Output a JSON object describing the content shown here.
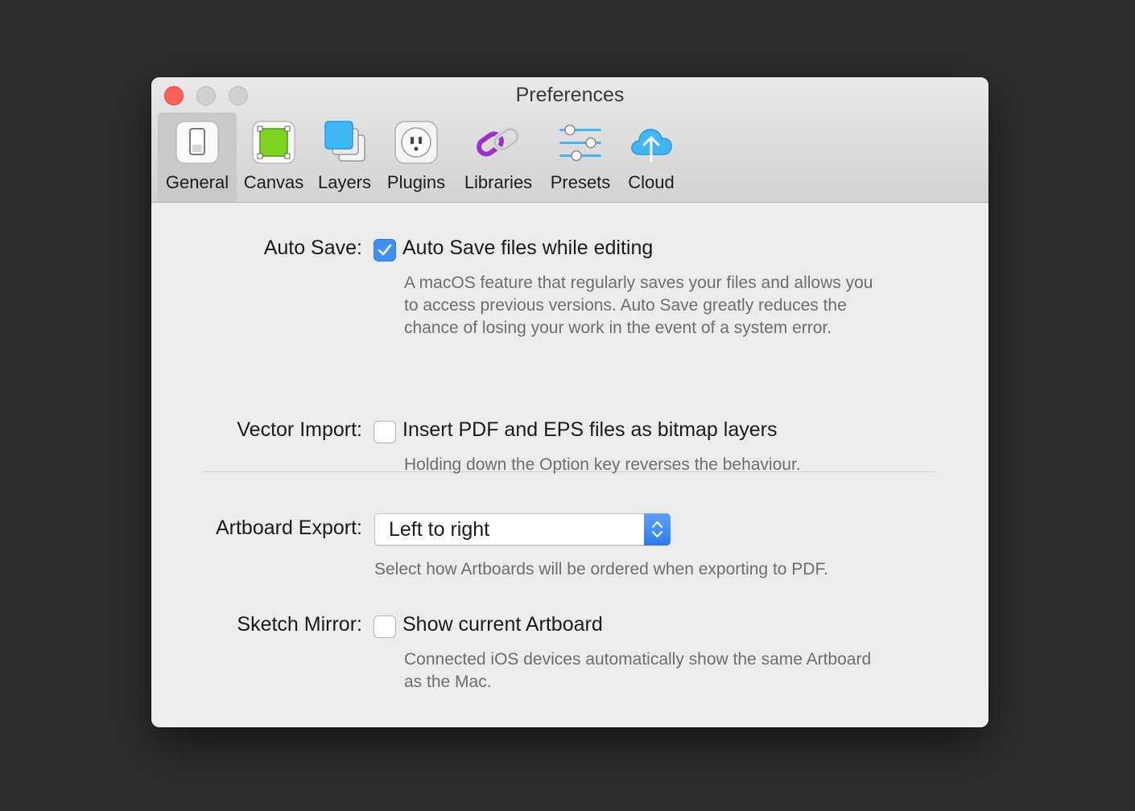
{
  "window": {
    "title": "Preferences"
  },
  "toolbar": {
    "tabs": [
      {
        "label": "General",
        "icon": "switch-icon",
        "selected": true
      },
      {
        "label": "Canvas",
        "icon": "canvas-icon",
        "selected": false
      },
      {
        "label": "Layers",
        "icon": "layers-icon",
        "selected": false
      },
      {
        "label": "Plugins",
        "icon": "plug-icon",
        "selected": false
      },
      {
        "label": "Libraries",
        "icon": "link-icon",
        "selected": false
      },
      {
        "label": "Presets",
        "icon": "sliders-icon",
        "selected": false
      },
      {
        "label": "Cloud",
        "icon": "cloud-upload-icon",
        "selected": false
      }
    ]
  },
  "settings": {
    "auto_save": {
      "label": "Auto Save:",
      "option": "Auto Save files while editing",
      "checked": true,
      "help": "A macOS feature that regularly saves your files and allows you to access previous versions. Auto Save greatly reduces the chance of losing your work in the event of a system error."
    },
    "vector_import": {
      "label": "Vector Import:",
      "option": "Insert PDF and EPS files as bitmap layers",
      "checked": false,
      "help": "Holding down the Option key reverses the behaviour."
    },
    "artboard_export": {
      "label": "Artboard Export:",
      "value": "Left to right",
      "help": "Select how Artboards will be ordered when exporting to PDF."
    },
    "sketch_mirror": {
      "label": "Sketch Mirror:",
      "option": "Show current Artboard",
      "checked": false,
      "help": "Connected iOS devices automatically show the same Artboard as the Mac."
    }
  },
  "colors": {
    "accent": "#3e8ff7",
    "close": "#fc605b"
  }
}
